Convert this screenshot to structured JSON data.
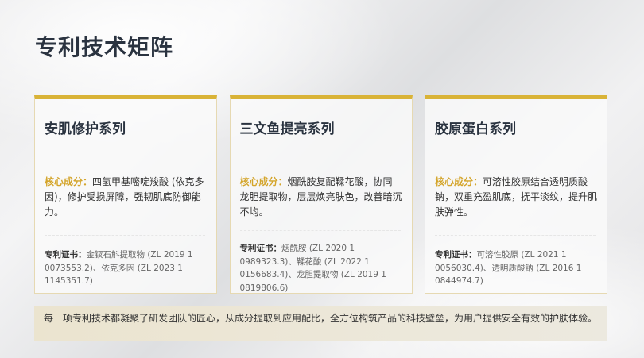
{
  "page": {
    "title": "专利技术矩阵"
  },
  "labels": {
    "ingredient": "核心成分：",
    "patent": "专利证书："
  },
  "cards": [
    {
      "title": "安肌修护系列",
      "ingredient": "四氢甲基嘧啶羧酸 (依克多因)，修护受损屏障，强韧肌底防御能力。",
      "patent": "金钗石斛提取物 (ZL 2019 1 0073553.2)、依克多因 (ZL 2023 1 1145351.7)"
    },
    {
      "title": "三文鱼提亮系列",
      "ingredient": "烟酰胺复配鞣花酸，协同龙胆提取物，层层焕亮肤色，改善暗沉不均。",
      "patent": "烟酰胺 (ZL 2020 1 0989323.3)、鞣花酸 (ZL 2022 1 0156683.4)、龙胆提取物 (ZL 2019 1 0819806.6)"
    },
    {
      "title": "胶原蛋白系列",
      "ingredient": "可溶性胶原结合透明质酸钠，双重充盈肌底，抚平淡纹，提升肌肤弹性。",
      "patent": "可溶性胶原 (ZL 2021 1 0056030.4)、透明质酸钠 (ZL 2016 1 0844974.7)"
    }
  ],
  "footer": {
    "text": "每一项专利技术都凝聚了研发团队的匠心，从成分提取到应用配比，全方位构筑产品的科技壁垒，为用户提供安全有效的护肤体验。"
  }
}
